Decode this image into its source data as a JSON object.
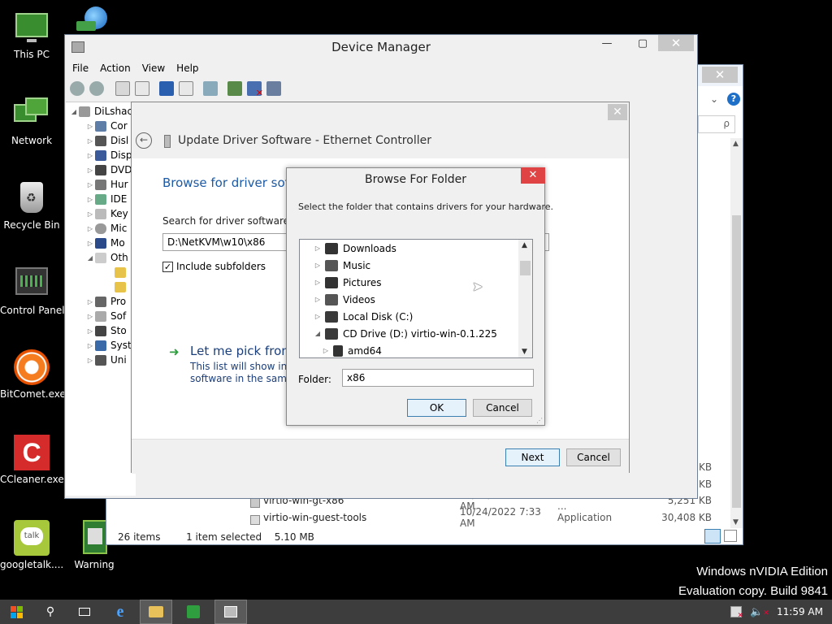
{
  "desktop": {
    "icons": [
      {
        "label": "This PC"
      },
      {
        "label": "Network"
      },
      {
        "label": "Recycle Bin"
      },
      {
        "label": "Control Panel"
      },
      {
        "label": "BitComet.exe"
      },
      {
        "label": "CCleaner.exe"
      },
      {
        "label": "googletalk...."
      },
      {
        "label": "Warning"
      }
    ],
    "watermark_line1": "Windows nVIDIA Edition",
    "watermark_line2": "Evaluation copy. Build 9841"
  },
  "explorer": {
    "search_placeholder": "ρ",
    "size_a": "KB",
    "size_b": "KB",
    "rows": [
      {
        "name": "virtio-win-gt-x86",
        "date": "10/24/2022 7:33 AM",
        "type": "Windows Installer ...",
        "size": "5,251 KB"
      },
      {
        "name": "virtio-win-guest-tools",
        "date": "10/24/2022 7:33 AM",
        "type": "Application",
        "size": "30,408 KB"
      }
    ],
    "status_items": "26 items",
    "status_selected": "1 item selected",
    "status_size": "5.10 MB"
  },
  "device_manager": {
    "title": "Device Manager",
    "menu": [
      "File",
      "Action",
      "View",
      "Help"
    ],
    "tree_root": "DiLshac",
    "tree_items": [
      "Cor",
      "Disl",
      "Disp",
      "DVD",
      "Hur",
      "IDE",
      "Key",
      "Mic",
      "Mo",
      "Oth",
      "",
      "",
      "Pro",
      "Sof",
      "Sto",
      "Syst",
      "Uni"
    ]
  },
  "wizard": {
    "title": "Update Driver Software - Ethernet Controller",
    "heading": "Browse for driver softw",
    "search_label": "Search for driver software in t",
    "path_value": "D:\\NetKVM\\w10\\x86",
    "include_subfolders": "Include subfolders",
    "pick_title": "Let me pick from",
    "pick_desc1": "This list will show insta",
    "pick_desc2": "software in the same c",
    "next_label": "Next",
    "cancel_label": "Cancel"
  },
  "browse_folder": {
    "title": "Browse For Folder",
    "instruction": "Select the folder that contains drivers for your hardware.",
    "tree": [
      {
        "label": "Downloads",
        "expanded": false
      },
      {
        "label": "Music",
        "expanded": false
      },
      {
        "label": "Pictures",
        "expanded": false
      },
      {
        "label": "Videos",
        "expanded": false
      },
      {
        "label": "Local Disk (C:)",
        "expanded": false
      },
      {
        "label": "CD Drive (D:) virtio-win-0.1.225",
        "expanded": true
      },
      {
        "label": "amd64",
        "expanded": false
      }
    ],
    "folder_label": "Folder:",
    "folder_value": "x86",
    "ok_label": "OK",
    "cancel_label": "Cancel"
  },
  "taskbar": {
    "clock": "11:59 AM"
  }
}
